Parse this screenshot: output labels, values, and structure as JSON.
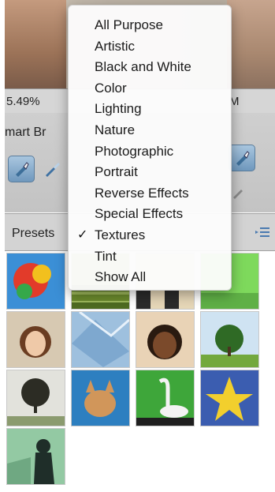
{
  "infobar": {
    "zoom": "5.49%",
    "trailing": "M"
  },
  "smart_brush": {
    "label": "mart Br"
  },
  "presets": {
    "label": "Presets"
  },
  "menu": {
    "items": [
      {
        "label": "All Purpose",
        "checked": false
      },
      {
        "label": "Artistic",
        "checked": false
      },
      {
        "label": "Black and White",
        "checked": false
      },
      {
        "label": "Color",
        "checked": false
      },
      {
        "label": "Lighting",
        "checked": false
      },
      {
        "label": "Nature",
        "checked": false
      },
      {
        "label": "Photographic",
        "checked": false
      },
      {
        "label": "Portrait",
        "checked": false
      },
      {
        "label": "Reverse Effects",
        "checked": false
      },
      {
        "label": "Special Effects",
        "checked": false
      },
      {
        "label": "Textures",
        "checked": true
      },
      {
        "label": "Tint",
        "checked": false
      },
      {
        "label": "Show All",
        "checked": false
      }
    ],
    "check_mark": "✓"
  },
  "thumbnails": [
    "parrot",
    "grass-rows",
    "checker-squares",
    "lime-green",
    "woman-portrait",
    "blue-texture",
    "girl-portrait",
    "tree-sky",
    "tree-dark",
    "cat",
    "swan-green",
    "yellow-star",
    "silhouette-green"
  ],
  "colors": {
    "accent": "#6f98bd",
    "menu_bg": "#fcfcfc"
  }
}
